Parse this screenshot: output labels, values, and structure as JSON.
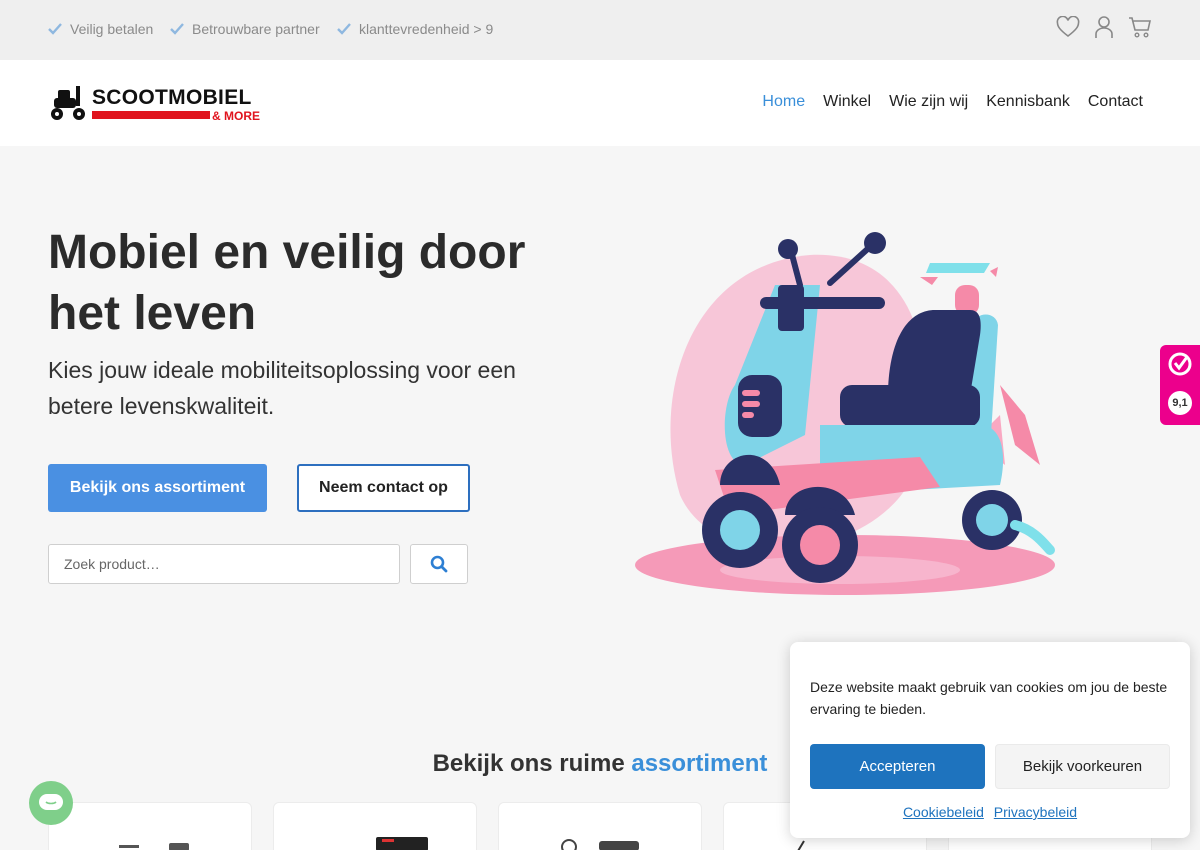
{
  "topbar": {
    "usps": [
      "Veilig betalen",
      "Betrouwbare partner",
      "klanttevredenheid > 9"
    ],
    "icons": [
      "heart-icon",
      "user-icon",
      "cart-icon"
    ]
  },
  "logo": {
    "title": "SCOOTMOBIEL",
    "subtitle": "& MORE"
  },
  "nav": {
    "items": [
      "Home",
      "Winkel",
      "Wie zijn wij",
      "Kennisbank",
      "Contact"
    ],
    "active": "Home"
  },
  "hero": {
    "title": "Mobiel en veilig door het leven",
    "subtitle": "Kies jouw ideale mobiliteitsoplossing voor een betere levenskwaliteit.",
    "primary_button": "Bekijk ons assortiment",
    "secondary_button": "Neem contact op",
    "search_placeholder": "Zoek product…"
  },
  "rating": {
    "value": "9,1"
  },
  "section": {
    "title_plain": "Bekijk ons ruime ",
    "title_accent": "assortiment"
  },
  "cookie": {
    "text": "Deze website maakt gebruik van cookies om jou de beste ervaring te bieden.",
    "accept": "Accepteren",
    "preferences": "Bekijk voorkeuren",
    "link_cookie": "Cookiebeleid",
    "link_privacy": "Privacybeleid"
  },
  "colors": {
    "accent": "#4a90e2",
    "nav_active": "#3a8fd9",
    "brand_red": "#e0141e",
    "cookie_blue": "#1e73be",
    "rating_pink": "#ec008c"
  }
}
